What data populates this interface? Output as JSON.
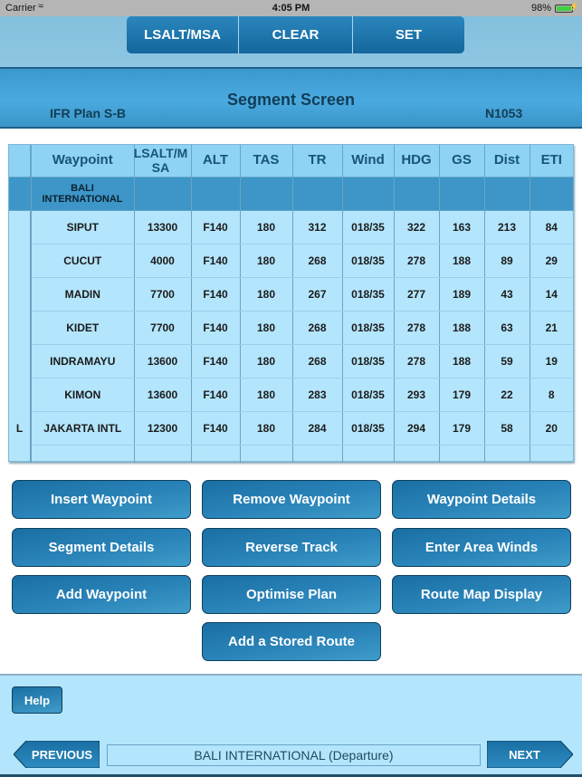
{
  "status_bar": {
    "carrier": "Carrier",
    "time": "4:05 PM",
    "battery": "98%"
  },
  "segmented_control": {
    "items": [
      "LSALT/MSA",
      "CLEAR",
      "SET"
    ]
  },
  "header": {
    "title": "Segment Screen",
    "plan_name": "IFR Plan S-B",
    "registration": "N1053"
  },
  "table": {
    "columns": [
      "",
      "Waypoint",
      "LSALT/MSA",
      "ALT",
      "TAS",
      "TR",
      "Wind",
      "HDG",
      "GS",
      "Dist",
      "ETI"
    ],
    "departure": {
      "flag": "",
      "waypoint": "BALI INTERNATIONAL"
    },
    "rows": [
      {
        "flag": "",
        "waypoint": "SIPUT",
        "lsalt": "13300",
        "alt": "F140",
        "tas": "180",
        "tr": "312",
        "wind": "018/35",
        "hdg": "322",
        "gs": "163",
        "dist": "213",
        "eti": "84"
      },
      {
        "flag": "",
        "waypoint": "CUCUT",
        "lsalt": "4000",
        "alt": "F140",
        "tas": "180",
        "tr": "268",
        "wind": "018/35",
        "hdg": "278",
        "gs": "188",
        "dist": "89",
        "eti": "29"
      },
      {
        "flag": "",
        "waypoint": "MADIN",
        "lsalt": "7700",
        "alt": "F140",
        "tas": "180",
        "tr": "267",
        "wind": "018/35",
        "hdg": "277",
        "gs": "189",
        "dist": "43",
        "eti": "14"
      },
      {
        "flag": "",
        "waypoint": "KIDET",
        "lsalt": "7700",
        "alt": "F140",
        "tas": "180",
        "tr": "268",
        "wind": "018/35",
        "hdg": "278",
        "gs": "188",
        "dist": "63",
        "eti": "21"
      },
      {
        "flag": "",
        "waypoint": "INDRAMAYU",
        "lsalt": "13600",
        "alt": "F140",
        "tas": "180",
        "tr": "268",
        "wind": "018/35",
        "hdg": "278",
        "gs": "188",
        "dist": "59",
        "eti": "19"
      },
      {
        "flag": "",
        "waypoint": "KIMON",
        "lsalt": "13600",
        "alt": "F140",
        "tas": "180",
        "tr": "283",
        "wind": "018/35",
        "hdg": "293",
        "gs": "179",
        "dist": "22",
        "eti": "8"
      },
      {
        "flag": "L",
        "waypoint": "JAKARTA INTL",
        "lsalt": "12300",
        "alt": "F140",
        "tas": "180",
        "tr": "284",
        "wind": "018/35",
        "hdg": "294",
        "gs": "179",
        "dist": "58",
        "eti": "20"
      }
    ]
  },
  "actions": {
    "insert_waypoint": "Insert Waypoint",
    "remove_waypoint": "Remove Waypoint",
    "waypoint_details": "Waypoint Details",
    "segment_details": "Segment Details",
    "reverse_track": "Reverse Track",
    "enter_area_winds": "Enter Area Winds",
    "add_waypoint": "Add Waypoint",
    "optimise_plan": "Optimise Plan",
    "route_map_display": "Route Map Display",
    "add_stored_route": "Add a Stored Route"
  },
  "footer": {
    "help": "Help",
    "previous": "PREVIOUS",
    "next": "NEXT",
    "current_location": "BALI INTERNATIONAL (Departure)"
  }
}
